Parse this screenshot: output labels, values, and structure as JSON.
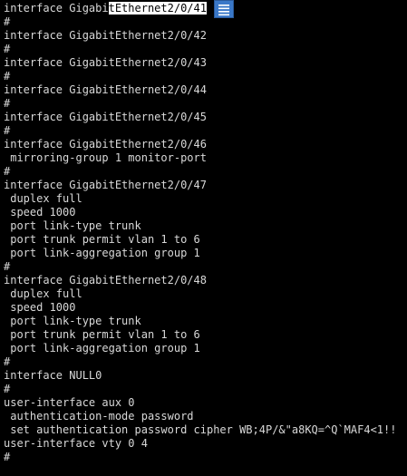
{
  "colors": {
    "background": "#000000",
    "text": "#d8d8d8",
    "selection_bg": "#ffffff",
    "selection_fg": "#000000",
    "overlay_button": "#3a78c8"
  },
  "overlay_button": {
    "icon": "menu-lines-icon"
  },
  "first_line": {
    "before": "interface Gigabi",
    "selected": "tEthernet2/0/41"
  },
  "lines": [
    "#",
    "interface GigabitEthernet2/0/42",
    "#",
    "interface GigabitEthernet2/0/43",
    "#",
    "interface GigabitEthernet2/0/44",
    "#",
    "interface GigabitEthernet2/0/45",
    "#",
    "interface GigabitEthernet2/0/46",
    " mirroring-group 1 monitor-port",
    "#",
    "interface GigabitEthernet2/0/47",
    " duplex full",
    " speed 1000",
    " port link-type trunk",
    " port trunk permit vlan 1 to 6",
    " port link-aggregation group 1",
    "#",
    "interface GigabitEthernet2/0/48",
    " duplex full",
    " speed 1000",
    " port link-type trunk",
    " port trunk permit vlan 1 to 6",
    " port link-aggregation group 1",
    "#",
    "interface NULL0",
    "#",
    "user-interface aux 0",
    " authentication-mode password",
    " set authentication password cipher WB;4P/&\"a8KQ=^Q`MAF4<1!!",
    "user-interface vty 0 4",
    "#"
  ]
}
